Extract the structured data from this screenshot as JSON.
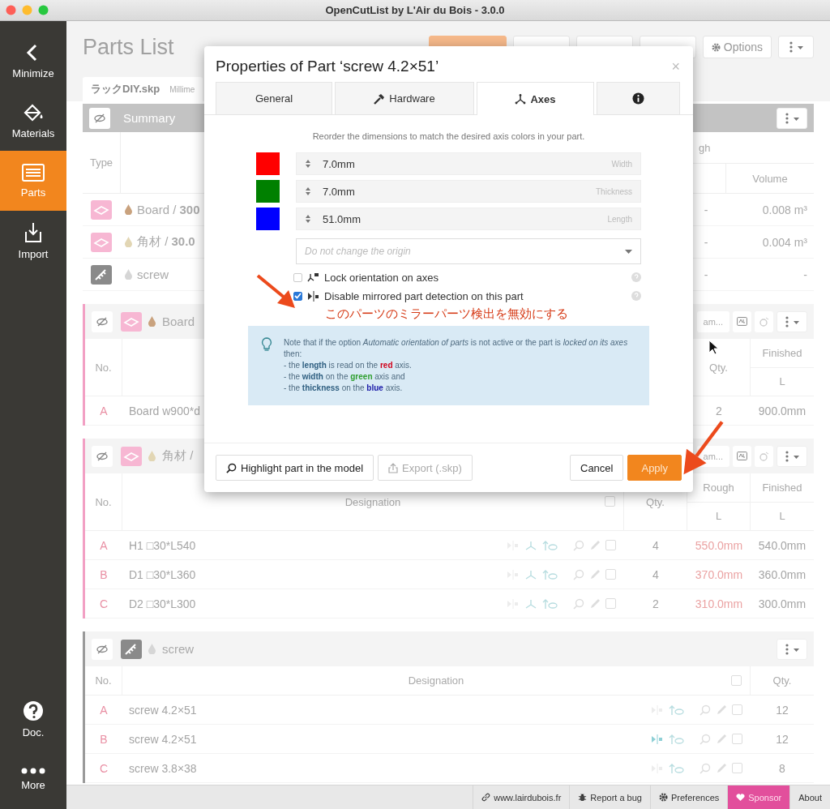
{
  "window": {
    "title": "OpenCutList by L'Air du Bois - 3.0.0"
  },
  "sidebar": {
    "top_items": [
      {
        "kind": "minimize",
        "label": "Minimize",
        "selected": false
      },
      {
        "kind": "materials",
        "label": "Materials",
        "selected": false
      },
      {
        "kind": "parts",
        "label": "Parts",
        "selected": true
      },
      {
        "kind": "import",
        "label": "Import",
        "selected": false
      }
    ],
    "bottom_items": [
      {
        "kind": "doc",
        "label": "Doc.",
        "selected": false
      },
      {
        "kind": "more",
        "label": "More",
        "selected": false
      }
    ]
  },
  "header": {
    "title": "Parts List",
    "options_button": "Options",
    "file_name": "ラックDIY.skp",
    "unit": "Millime"
  },
  "summary": {
    "title": "Summary",
    "type_heading": "Type",
    "group_heading": "gh",
    "volume_heading": "Volume",
    "rows": [
      {
        "kind": "board",
        "color": "#c9a27e",
        "name": "Board / **300**",
        "count": "-",
        "volume": "0.008 m³"
      },
      {
        "kind": "board",
        "color": "#e2d6b4",
        "name": "角材 / **30.0**",
        "count": "-",
        "volume": "0.004 m³"
      },
      {
        "kind": "hardware",
        "color": "#d6d6d6",
        "name": "screw",
        "count": "-",
        "volume": "-"
      }
    ]
  },
  "groups": [
    {
      "kind": "board",
      "color": "#f2a0c4",
      "material": {
        "color": "#c9a27e"
      },
      "title": "Board",
      "name_button": "am...",
      "headings": [
        {
          "kind": "no",
          "label": "No."
        },
        {
          "kind": "designation"
        },
        {
          "kind": "qty",
          "label": "Qty."
        },
        {
          "kind": "finished",
          "label": "Finished",
          "sub": "L"
        }
      ],
      "rows": [
        {
          "letter": "A",
          "name": "Board w900*d",
          "cells": [
            "2",
            "900.0mm"
          ]
        }
      ]
    },
    {
      "kind": "board",
      "color": "#f2a0c4",
      "material": {
        "color": "#e2d6b4"
      },
      "title": "角材 /",
      "name_button": "am...",
      "headings": [
        {
          "kind": "no",
          "label": "No."
        },
        {
          "kind": "designation",
          "label": "Designation",
          "checked": false
        },
        {
          "kind": "qty",
          "label": "Qty."
        },
        {
          "kind": "rough",
          "label": "Rough",
          "sub": "L"
        },
        {
          "kind": "finished",
          "label": "Finished",
          "sub": "L"
        }
      ],
      "rows": [
        {
          "letter": "A",
          "name": "H1 □30*L540",
          "mirror": false,
          "cells": [
            "4",
            "550.0mm",
            "540.0mm"
          ]
        },
        {
          "letter": "B",
          "name": "D1 □30*L360",
          "mirror": false,
          "cells": [
            "4",
            "370.0mm",
            "360.0mm"
          ]
        },
        {
          "letter": "C",
          "name": "D2 □30*L300",
          "mirror": false,
          "cells": [
            "2",
            "310.0mm",
            "300.0mm"
          ]
        }
      ]
    },
    {
      "kind": "hardware",
      "color": "#9a9a9a",
      "material": {
        "color": "#d6d6d6"
      },
      "title": "screw",
      "headings": [
        {
          "kind": "no",
          "label": "No."
        },
        {
          "kind": "designation",
          "label": "Designation",
          "checked": false
        },
        {
          "kind": "qty",
          "label": "Qty."
        }
      ],
      "rows": [
        {
          "letter": "A",
          "name": "screw 4.2×51",
          "mirror": false,
          "cells": [
            "12"
          ]
        },
        {
          "letter": "B",
          "name": "screw 4.2×51",
          "mirror": true,
          "cells": [
            "12"
          ]
        },
        {
          "letter": "C",
          "name": "screw 3.8×38",
          "mirror": false,
          "cells": [
            "8"
          ]
        }
      ]
    }
  ],
  "status_bar": [
    {
      "kind": "link",
      "label": "www.lairdubois.fr"
    },
    {
      "kind": "bug",
      "label": "Report a bug"
    },
    {
      "kind": "gear",
      "label": "Preferences"
    },
    {
      "kind": "sponsor",
      "label": "Sponsor"
    },
    {
      "kind": "plain",
      "label": "About"
    }
  ],
  "dialog": {
    "title": "Properties of Part ‘screw 4.2×51’",
    "close": "×",
    "tabs": [
      {
        "kind": "text",
        "label": "General",
        "selected": false
      },
      {
        "kind": "hardware",
        "label": "Hardware",
        "selected": false
      },
      {
        "kind": "axes",
        "label": "Axes",
        "selected": true
      },
      {
        "kind": "info",
        "selected": false
      }
    ],
    "intro": "Reorder the dimensions to match the desired axis colors in your part.",
    "axes": [
      {
        "color": "#ff0000",
        "value": "7.0mm",
        "label": "Width"
      },
      {
        "color": "#008000",
        "value": "7.0mm",
        "label": "Thickness"
      },
      {
        "color": "#0000ff",
        "value": "51.0mm",
        "label": "Length"
      }
    ],
    "origin_placeholder": "Do not change the origin",
    "options": [
      {
        "kind": "lock",
        "label": "Lock orientation on axes",
        "checked": false
      },
      {
        "kind": "mirror",
        "label": "Disable mirrored part detection on this part",
        "checked": true
      }
    ],
    "annotation": "このパーツのミラーパーツ検出を無効にする",
    "note_lines": [
      {
        "text": "Note that if the option *Automatic orientation of parts* is not active or the part is *locked on its axes* then:"
      },
      {
        "text": "- the **length** is read on the **red** axis.",
        "color": "#d0021b"
      },
      {
        "text": "- the **width** on the **green** axis and",
        "color": "#2e9e2e"
      },
      {
        "text": "- the **thickness** on the **blue** axis.",
        "color": "#1a1aa8"
      }
    ],
    "buttons": [
      {
        "kind": "highlight",
        "label": "Highlight part in the model",
        "disabled": false
      },
      {
        "kind": "export",
        "label": "Export (.skp)",
        "disabled": true
      },
      {
        "kind": "cancel",
        "label": "Cancel",
        "disabled": false
      },
      {
        "kind": "primary",
        "label": "Apply",
        "disabled": false
      }
    ]
  }
}
